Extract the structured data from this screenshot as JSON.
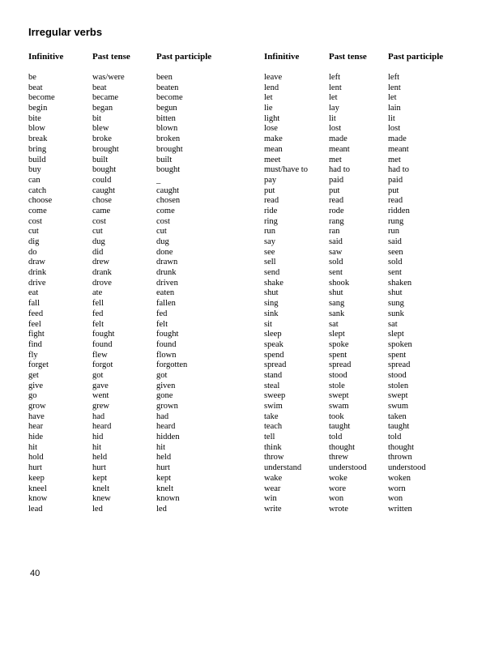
{
  "title": "Irregular verbs",
  "page_number": "40",
  "headers": [
    "Infinitive",
    "Past tense",
    "Past participle"
  ],
  "left_table": [
    [
      "be",
      "was/were",
      "been"
    ],
    [
      "beat",
      "beat",
      "beaten"
    ],
    [
      "become",
      "became",
      "become"
    ],
    [
      "begin",
      "began",
      "begun"
    ],
    [
      "bite",
      "bit",
      "bitten"
    ],
    [
      "blow",
      "blew",
      "blown"
    ],
    [
      "break",
      "broke",
      "broken"
    ],
    [
      "bring",
      "brought",
      "brought"
    ],
    [
      "build",
      "built",
      "built"
    ],
    [
      "buy",
      "bought",
      "bought"
    ],
    [
      "can",
      "could",
      "_"
    ],
    [
      "catch",
      "caught",
      "caught"
    ],
    [
      "choose",
      "chose",
      "chosen"
    ],
    [
      "come",
      "came",
      "come"
    ],
    [
      "cost",
      "cost",
      "cost"
    ],
    [
      "cut",
      "cut",
      "cut"
    ],
    [
      "dig",
      "dug",
      "dug"
    ],
    [
      "do",
      "did",
      "done"
    ],
    [
      "draw",
      "drew",
      "drawn"
    ],
    [
      "drink",
      "drank",
      "drunk"
    ],
    [
      "drive",
      "drove",
      "driven"
    ],
    [
      "eat",
      "ate",
      "eaten"
    ],
    [
      "fall",
      "fell",
      "fallen"
    ],
    [
      "feed",
      "fed",
      "fed"
    ],
    [
      "feel",
      "felt",
      "felt"
    ],
    [
      "fight",
      "fought",
      "fought"
    ],
    [
      "find",
      "found",
      "found"
    ],
    [
      "fly",
      "flew",
      "flown"
    ],
    [
      "forget",
      "forgot",
      "forgotten"
    ],
    [
      "get",
      "got",
      "got"
    ],
    [
      "give",
      "gave",
      "given"
    ],
    [
      "go",
      "went",
      "gone"
    ],
    [
      "grow",
      "grew",
      "grown"
    ],
    [
      "have",
      "had",
      "had"
    ],
    [
      "hear",
      "heard",
      "heard"
    ],
    [
      "hide",
      "hid",
      "hidden"
    ],
    [
      "hit",
      "hit",
      "hit"
    ],
    [
      "hold",
      "held",
      "held"
    ],
    [
      "hurt",
      "hurt",
      "hurt"
    ],
    [
      "keep",
      "kept",
      "kept"
    ],
    [
      "kneel",
      "knelt",
      "knelt"
    ],
    [
      "know",
      "knew",
      "known"
    ],
    [
      "lead",
      "led",
      "led"
    ]
  ],
  "right_table": [
    [
      "leave",
      "left",
      "left"
    ],
    [
      "lend",
      "lent",
      "lent"
    ],
    [
      "let",
      "let",
      "let"
    ],
    [
      "lie",
      "lay",
      "lain"
    ],
    [
      "light",
      "lit",
      "lit"
    ],
    [
      "lose",
      "lost",
      "lost"
    ],
    [
      "make",
      "made",
      "made"
    ],
    [
      "mean",
      "meant",
      "meant"
    ],
    [
      "meet",
      "met",
      "met"
    ],
    [
      "must/have to",
      "had to",
      "had to"
    ],
    [
      "pay",
      "paid",
      "paid"
    ],
    [
      "put",
      "put",
      "put"
    ],
    [
      "read",
      "read",
      "read"
    ],
    [
      "ride",
      "rode",
      "ridden"
    ],
    [
      "ring",
      "rang",
      "rung"
    ],
    [
      "run",
      "ran",
      "run"
    ],
    [
      "say",
      "said",
      "said"
    ],
    [
      "see",
      "saw",
      "seen"
    ],
    [
      "sell",
      "sold",
      "sold"
    ],
    [
      "send",
      "sent",
      "sent"
    ],
    [
      "shake",
      "shook",
      "shaken"
    ],
    [
      "shut",
      "shut",
      "shut"
    ],
    [
      "sing",
      "sang",
      "sung"
    ],
    [
      "sink",
      "sank",
      "sunk"
    ],
    [
      "sit",
      "sat",
      "sat"
    ],
    [
      "sleep",
      "slept",
      "slept"
    ],
    [
      "speak",
      "spoke",
      "spoken"
    ],
    [
      "spend",
      "spent",
      "spent"
    ],
    [
      "spread",
      "spread",
      "spread"
    ],
    [
      "stand",
      "stood",
      "stood"
    ],
    [
      "steal",
      "stole",
      "stolen"
    ],
    [
      "sweep",
      "swept",
      "swept"
    ],
    [
      "swim",
      "swam",
      "swum"
    ],
    [
      "take",
      "took",
      "taken"
    ],
    [
      "teach",
      "taught",
      "taught"
    ],
    [
      "tell",
      "told",
      "told"
    ],
    [
      "think",
      "thought",
      "thought"
    ],
    [
      "throw",
      "threw",
      "thrown"
    ],
    [
      "understand",
      "understood",
      "understood"
    ],
    [
      "wake",
      "woke",
      "woken"
    ],
    [
      "wear",
      "wore",
      "worn"
    ],
    [
      "win",
      "won",
      "won"
    ],
    [
      "write",
      "wrote",
      "written"
    ]
  ]
}
